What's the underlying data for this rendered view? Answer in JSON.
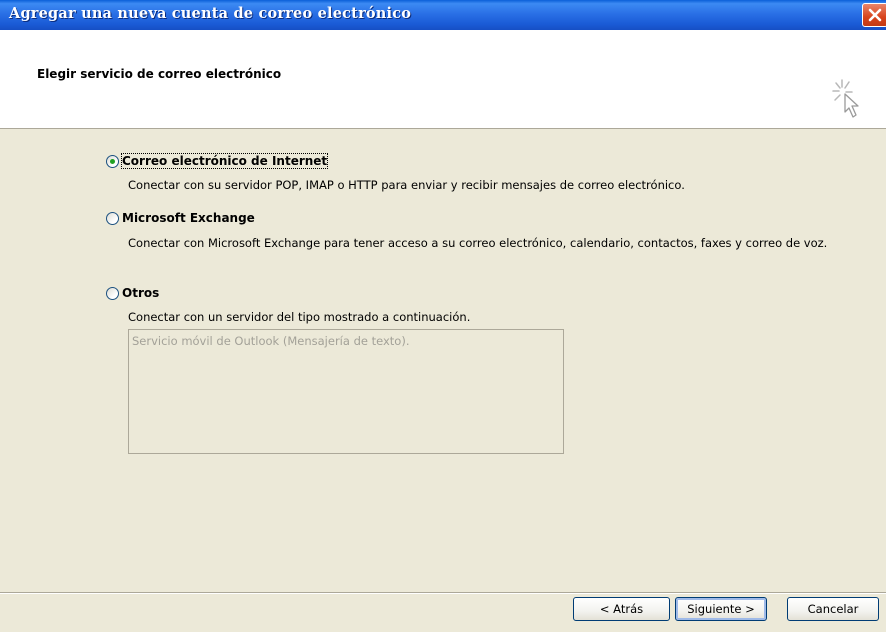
{
  "window": {
    "title": "Agregar una nueva cuenta de correo electrónico"
  },
  "header": {
    "title": "Elegir servicio de correo electrónico"
  },
  "options": [
    {
      "label": "Correo electrónico de Internet",
      "selected": true,
      "description": "Conectar con su servidor POP, IMAP o HTTP para enviar y recibir mensajes de correo electrónico."
    },
    {
      "label": "Microsoft Exchange",
      "selected": false,
      "description": "Conectar con Microsoft Exchange para tener acceso a su correo electrónico, calendario, contactos, faxes y correo de voz."
    },
    {
      "label": "Otros",
      "selected": false,
      "description": "Conectar con un servidor del tipo mostrado a continuación."
    }
  ],
  "other_services": [
    "Servicio móvil de Outlook (Mensajería de texto)."
  ],
  "buttons": {
    "back": "< Atrás",
    "next": "Siguiente >",
    "cancel": "Cancelar"
  },
  "colors": {
    "titlebar": "#2a70e6",
    "close": "#d8441c",
    "dialog": "#ece9d8",
    "radio_dot": "#21a121"
  },
  "icons": {
    "close": "close-icon",
    "wizard": "wizard-cursor-icon"
  }
}
